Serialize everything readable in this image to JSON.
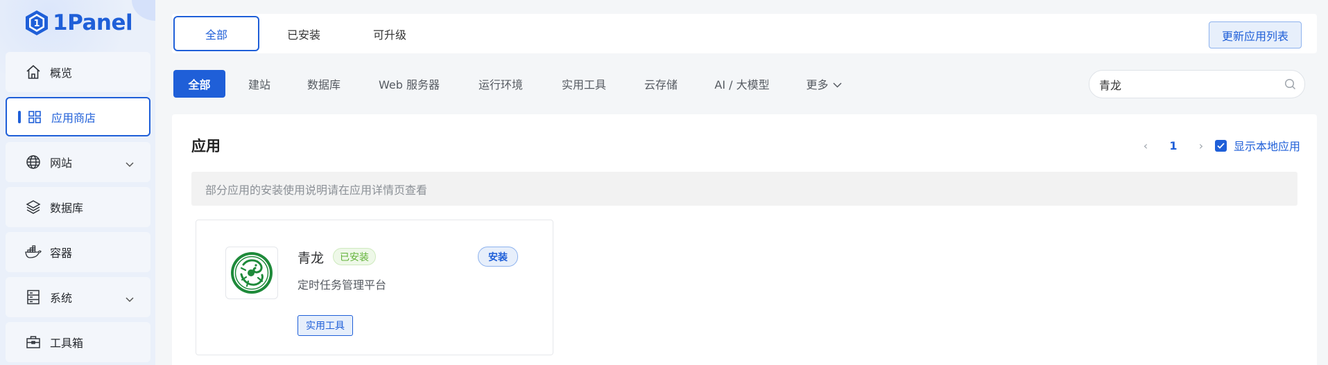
{
  "brand": {
    "name": "1Panel",
    "color": "#1f5fd8"
  },
  "sidebar": {
    "items": [
      {
        "label": "概览",
        "icon": "home-icon",
        "expandable": false,
        "active": false
      },
      {
        "label": "应用商店",
        "icon": "grid-icon",
        "expandable": false,
        "active": true
      },
      {
        "label": "网站",
        "icon": "globe-icon",
        "expandable": true,
        "active": false
      },
      {
        "label": "数据库",
        "icon": "layers-icon",
        "expandable": false,
        "active": false
      },
      {
        "label": "容器",
        "icon": "docker-icon",
        "expandable": false,
        "active": false
      },
      {
        "label": "系统",
        "icon": "server-icon",
        "expandable": true,
        "active": false
      },
      {
        "label": "工具箱",
        "icon": "toolbox-icon",
        "expandable": false,
        "active": false
      }
    ]
  },
  "top_tabs": {
    "tabs": [
      {
        "label": "全部",
        "active": true
      },
      {
        "label": "已安装",
        "active": false
      },
      {
        "label": "可升级",
        "active": false
      }
    ],
    "update_button": "更新应用列表"
  },
  "categories": {
    "items": [
      {
        "label": "全部",
        "active": true
      },
      {
        "label": "建站",
        "active": false
      },
      {
        "label": "数据库",
        "active": false
      },
      {
        "label": "Web 服务器",
        "active": false
      },
      {
        "label": "运行环境",
        "active": false
      },
      {
        "label": "实用工具",
        "active": false
      },
      {
        "label": "云存储",
        "active": false
      },
      {
        "label": "AI / 大模型",
        "active": false
      },
      {
        "label": "更多",
        "active": false
      }
    ],
    "search_value": "青龙"
  },
  "main": {
    "title": "应用",
    "pager": {
      "current_page": "1",
      "prev_icon": "chevron-left-icon",
      "next_icon": "chevron-right-icon"
    },
    "show_local": {
      "label": "显示本地应用",
      "checked": true
    },
    "notice": "部分应用的安装使用说明请在应用详情页查看"
  },
  "apps": [
    {
      "name": "青龙",
      "status_tag": "已安装",
      "description": "定时任务管理平台",
      "install_label": "安装",
      "category_tag": "实用工具",
      "icon": "qinglong-dragon-logo",
      "icon_color": "#1e8a3a"
    }
  ]
}
